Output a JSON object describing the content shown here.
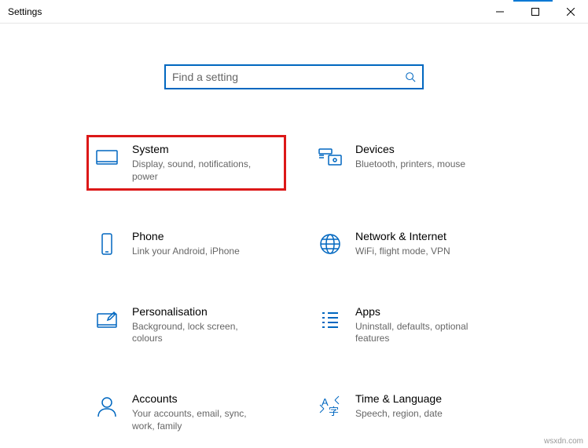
{
  "window": {
    "title": "Settings"
  },
  "search": {
    "placeholder": "Find a setting"
  },
  "tiles": {
    "system": {
      "title": "System",
      "desc": "Display, sound, notifications, power"
    },
    "devices": {
      "title": "Devices",
      "desc": "Bluetooth, printers, mouse"
    },
    "phone": {
      "title": "Phone",
      "desc": "Link your Android, iPhone"
    },
    "network": {
      "title": "Network & Internet",
      "desc": "WiFi, flight mode, VPN"
    },
    "personalisation": {
      "title": "Personalisation",
      "desc": "Background, lock screen, colours"
    },
    "apps": {
      "title": "Apps",
      "desc": "Uninstall, defaults, optional features"
    },
    "accounts": {
      "title": "Accounts",
      "desc": "Your accounts, email, sync, work, family"
    },
    "time": {
      "title": "Time & Language",
      "desc": "Speech, region, date"
    }
  },
  "watermark": "wsxdn.com"
}
